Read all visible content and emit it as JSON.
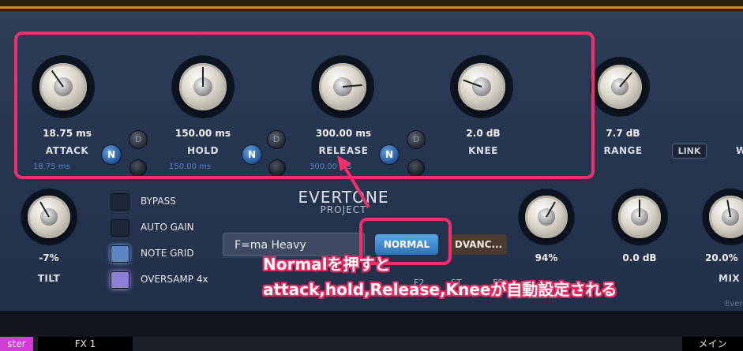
{
  "knobs": [
    {
      "id": "attack",
      "value": "18.75 ms",
      "label": "ATTACK",
      "sub": "18.75 ms"
    },
    {
      "id": "hold",
      "value": "150.00 ms",
      "label": "HOLD",
      "sub": "150.00 ms"
    },
    {
      "id": "release",
      "value": "300.00 ms",
      "label": "RELEASE",
      "sub": "300.00 ms"
    },
    {
      "id": "knee",
      "value": "2.0 dB",
      "label": "KNEE"
    },
    {
      "id": "range",
      "value": "7.7 dB",
      "label": "RANGE"
    },
    {
      "id": "tilt",
      "value": "-7%",
      "label": "TILT"
    },
    {
      "id": "k94",
      "value": "94%"
    },
    {
      "id": "k0db",
      "value": "0.0 dB"
    },
    {
      "id": "mix",
      "value": "20.0%",
      "label": "MIX"
    }
  ],
  "buttons": {
    "n": "N",
    "d": "D",
    "link": "LINK",
    "normal": "NORMAL",
    "advanced": "DVANC..."
  },
  "toggles": [
    {
      "label": "BYPASS"
    },
    {
      "label": "AUTO GAIN"
    },
    {
      "label": "NOTE GRID"
    },
    {
      "label": "OVERSAMP 4x"
    }
  ],
  "preset": {
    "name": "F=ma Heavy"
  },
  "logo": {
    "line1": "EVERTONE",
    "line2": "PROJECT"
  },
  "annotation": {
    "line1": "Normalを押すと",
    "line2": "attack,hold,Release,Kneeが自動設定される"
  },
  "tabs": {
    "left": "ster",
    "fx1": "FX 1",
    "right": "メイン"
  },
  "partial": {
    "w": "W",
    "ever": "Ever",
    "f2": "F2",
    "st": "ST",
    "fs": "F5"
  },
  "colors": {
    "accent": "#3aa6e8",
    "highlight": "#f0306a"
  }
}
